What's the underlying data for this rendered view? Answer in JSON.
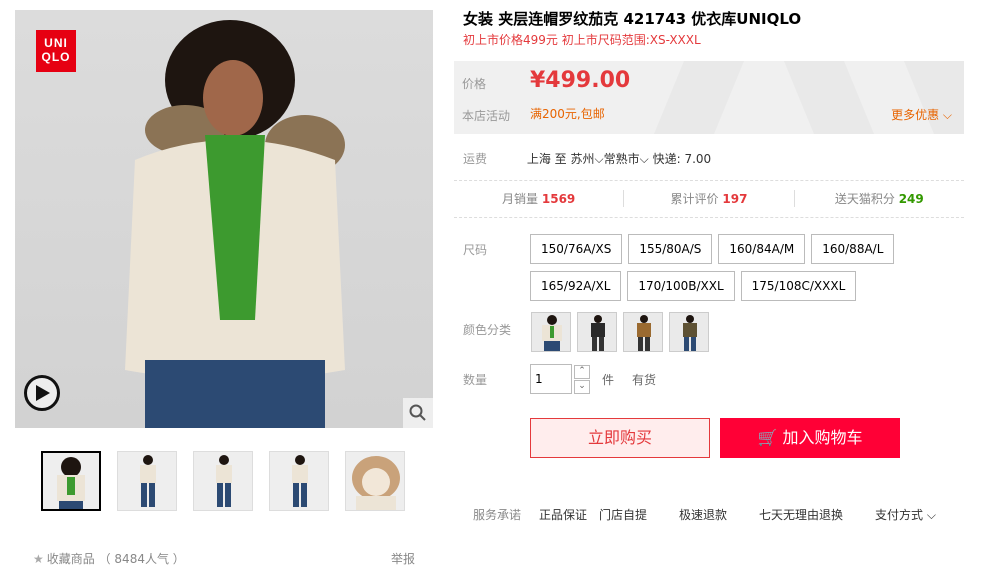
{
  "gallery": {
    "logo_text": "UNI QLO",
    "logo_color": "#e60012",
    "play_icon": "play-icon",
    "zoom_icon": "search-icon"
  },
  "product": {
    "title": "女装 夹层连帽罗纹茄克 421743 优衣库UNIQLO",
    "subtitle": "初上市价格499元 初上市尺码范围:XS-XXXL"
  },
  "price": {
    "label": "价格",
    "value": "¥499.00",
    "promo_label": "本店活动",
    "promo_value": "满200元,包邮",
    "more_deals": "更多优惠"
  },
  "shipping": {
    "label": "运费",
    "from": "上海",
    "to_word": "至",
    "city": "苏州",
    "district": "常熟市",
    "express": "快递: 7.00"
  },
  "stats": {
    "monthly_sales_label": "月销量",
    "monthly_sales": "1569",
    "reviews_label": "累计评价",
    "reviews": "197",
    "points_label": "送天猫积分",
    "points": "249"
  },
  "options": {
    "size_label": "尺码",
    "sizes": [
      "150/76A/XS",
      "155/80A/S",
      "160/84A/M",
      "160/88A/L",
      "165/92A/XL",
      "170/100B/XXL",
      "175/108C/XXXL"
    ],
    "color_label": "颜色分类",
    "qty_label": "数量",
    "qty_value": "1",
    "qty_unit": "件",
    "stock": "有货"
  },
  "actions": {
    "buy_now": "立即购买",
    "add_cart": "加入购物车"
  },
  "services": {
    "label": "服务承诺",
    "items": [
      "正品保证",
      "门店自提",
      "极速退款",
      "七天无理由退换"
    ],
    "payment": "支付方式"
  },
  "footer": {
    "favorite": "收藏商品",
    "favorite_count": "（ 8484人气 ）",
    "report": "举报"
  },
  "colors": {
    "accent_red": "#e4393c",
    "cart_red": "#ff0036",
    "promo_orange": "#e86400",
    "green": "#339900"
  }
}
